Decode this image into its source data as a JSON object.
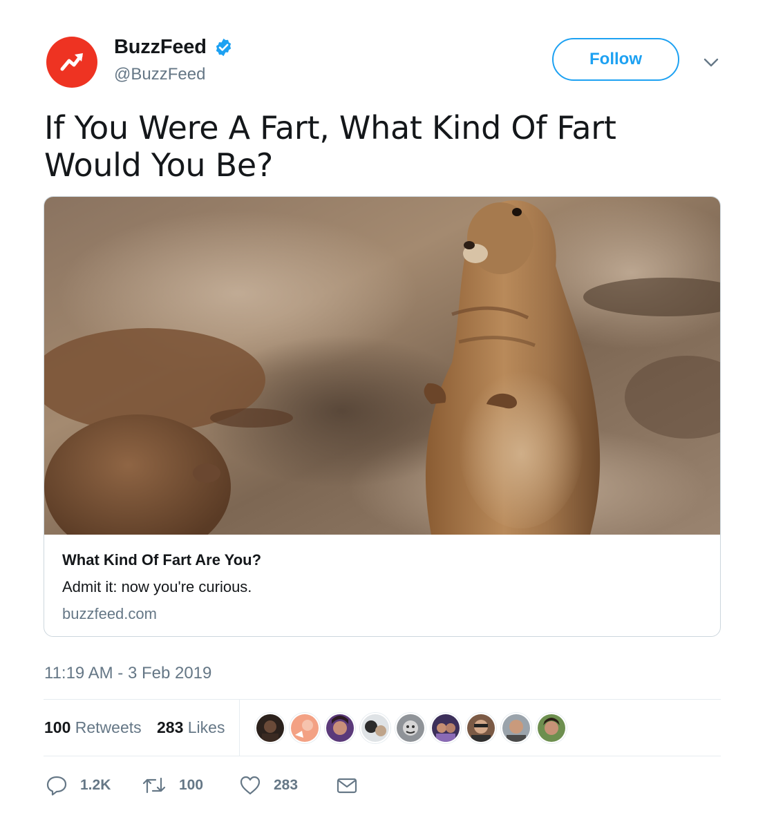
{
  "colors": {
    "brand_red": "#ee3322",
    "twitter_blue": "#1da1f2",
    "text_primary": "#14171a",
    "text_secondary": "#657786",
    "border": "#ccd6dd"
  },
  "author": {
    "display_name": "BuzzFeed",
    "handle": "@BuzzFeed",
    "verified": true,
    "avatar_icon": "buzzfeed-trending-arrow-logo"
  },
  "header": {
    "follow_label": "Follow",
    "menu_icon": "chevron-down-icon"
  },
  "tweet": {
    "text": "If You Were A Fart, What Kind Of Fart Would You Be?"
  },
  "card": {
    "image_icon": "prairie-dog-photo",
    "title": "What Kind Of Fart Are You?",
    "description": "Admit it: now you're curious.",
    "domain": "buzzfeed.com"
  },
  "meta": {
    "timestamp": "11:19 AM - 3 Feb 2019"
  },
  "stats": {
    "retweets_count": "100",
    "retweets_label": "Retweets",
    "likes_count": "283",
    "likes_label": "Likes",
    "liker_avatar_count": 9
  },
  "actions": {
    "reply_count": "1.2K",
    "retweet_count": "100",
    "like_count": "283",
    "reply_icon": "reply-icon",
    "retweet_icon": "retweet-icon",
    "like_icon": "heart-icon",
    "dm_icon": "envelope-icon"
  }
}
